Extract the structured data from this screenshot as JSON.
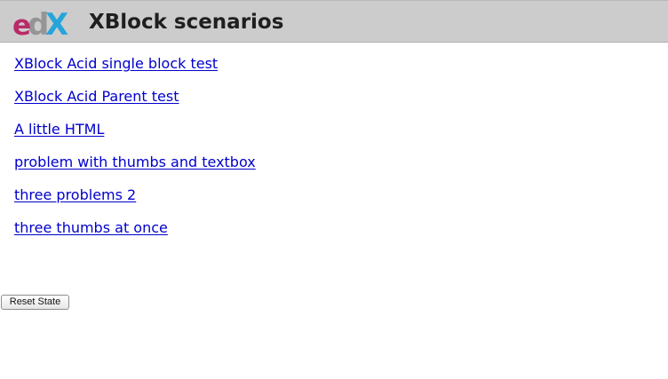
{
  "header": {
    "logo_text": "edX",
    "title": "XBlock scenarios"
  },
  "scenarios": [
    {
      "label": "XBlock Acid single block test"
    },
    {
      "label": "XBlock Acid Parent test"
    },
    {
      "label": "A little HTML"
    },
    {
      "label": "problem with thumbs and textbox"
    },
    {
      "label": "three problems 2"
    },
    {
      "label": "three thumbs at once"
    }
  ],
  "reset_label": "Reset State",
  "colors": {
    "header_bg": "#cccccc",
    "link": "#0000cc",
    "logo_e": "#b8195e",
    "logo_d": "#8c8c8c",
    "logo_x": "#1ea3dc"
  }
}
